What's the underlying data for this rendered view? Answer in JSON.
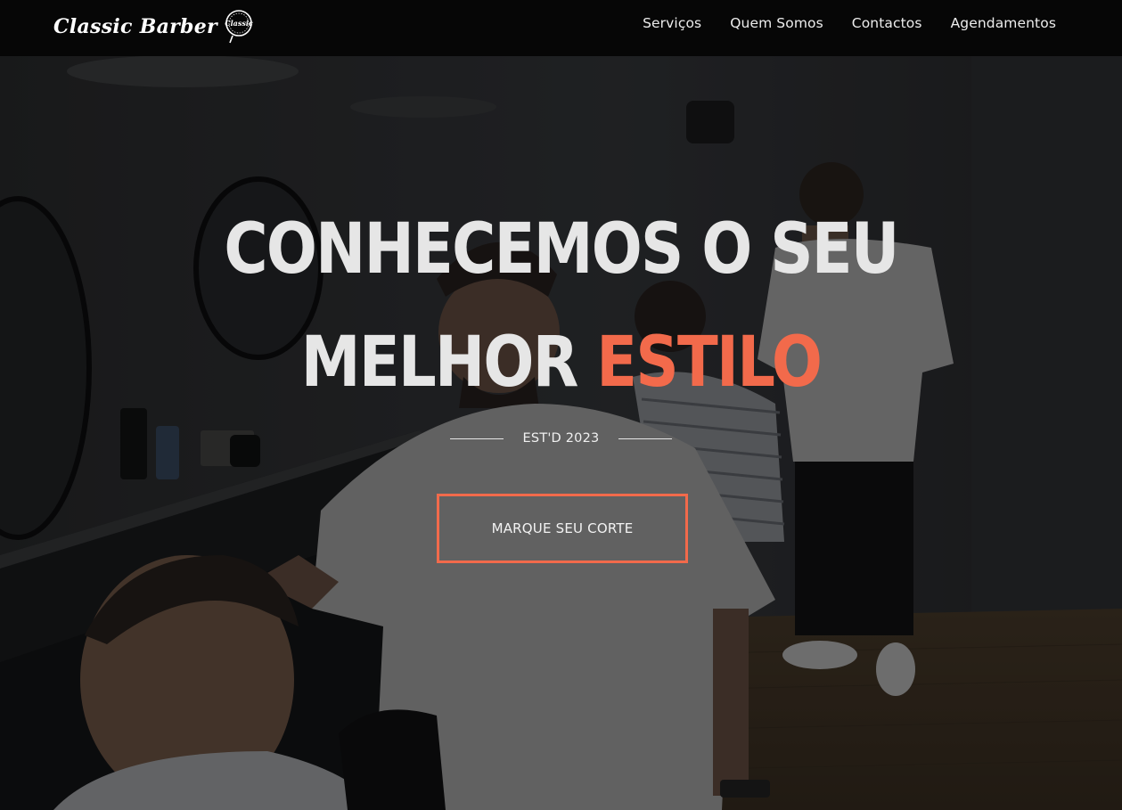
{
  "brand": {
    "name": "Classic Barber",
    "logo_text": "Classic"
  },
  "nav": {
    "items": [
      {
        "label": "Serviços"
      },
      {
        "label": "Quem Somos"
      },
      {
        "label": "Contactos"
      },
      {
        "label": "Agendamentos"
      }
    ]
  },
  "hero": {
    "headline_line1": "CONHECEMOS O SEU",
    "headline_line2_plain": "MELHOR",
    "headline_line2_accent": "ESTILO",
    "established": "EST'D 2023",
    "cta_label": "MARQUE SEU CORTE"
  },
  "colors": {
    "accent": "#f26a4b",
    "nav_background": "#060606",
    "headline": "#e6e6e6"
  }
}
